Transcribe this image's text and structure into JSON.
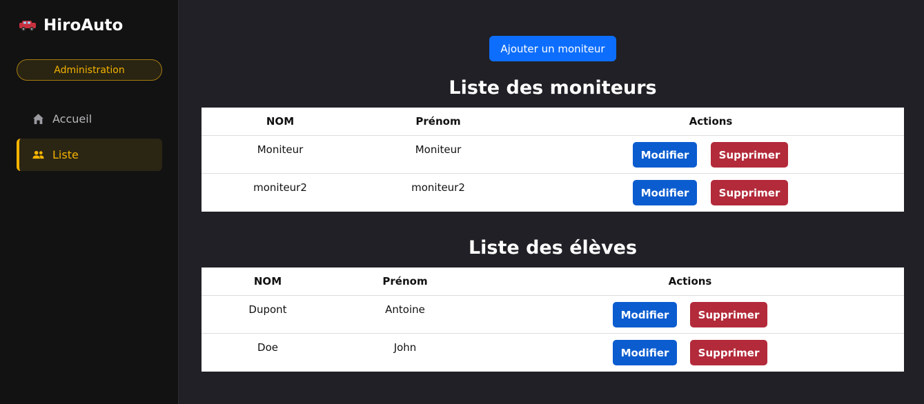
{
  "sidebar": {
    "brand": "HiroAuto",
    "brand_icon": "car-icon",
    "role_badge": "Administration",
    "items": [
      {
        "label": "Accueil",
        "icon": "home-icon",
        "active": false
      },
      {
        "label": "Liste",
        "icon": "users-icon",
        "active": true
      }
    ]
  },
  "main": {
    "add_button": "Ajouter un moniteur",
    "moniteurs": {
      "title": "Liste des moniteurs",
      "columns": [
        "NOM",
        "Prénom",
        "Actions"
      ],
      "rows": [
        {
          "nom": "Moniteur",
          "prenom": "Moniteur"
        },
        {
          "nom": "moniteur2",
          "prenom": "moniteur2"
        }
      ]
    },
    "eleves": {
      "title": "Liste des élèves",
      "columns": [
        "NOM",
        "Prénom",
        "Actions"
      ],
      "rows": [
        {
          "nom": "Dupont",
          "prenom": "Antoine"
        },
        {
          "nom": "Doe",
          "prenom": "John"
        }
      ]
    },
    "edit_label": "Modifier",
    "delete_label": "Supprimer"
  },
  "colors": {
    "accent": "#f4b400",
    "primary": "#0d6efd",
    "edit": "#0b5ccf",
    "danger": "#b32a3a",
    "sidebar_bg": "#121212",
    "main_bg": "#202026"
  }
}
